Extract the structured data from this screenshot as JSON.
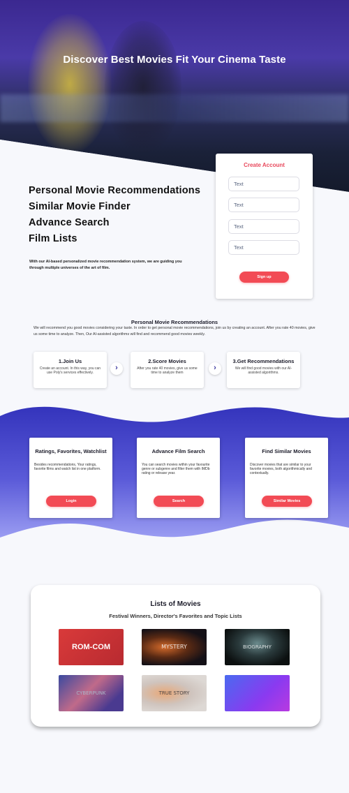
{
  "hero": {
    "title": "Discover Best Movies Fit Your Cinema Taste"
  },
  "features": [
    "Personal Movie Recommendations",
    "Similar Movie Finder",
    "Advance Search",
    "Film Lists"
  ],
  "intro": "With our AI-based personalized movie recommendation system, we are guiding you through multiple universes of the art of film.",
  "signup": {
    "title": "Create Account",
    "inputs": [
      "Text",
      "Text",
      "Text",
      "Text"
    ],
    "button": "Sign up"
  },
  "how": {
    "title": "Personal Movie Recommendations",
    "description": "We will recommend you good movies considering your taste. In order to get personal movie recommendations, join us by creating an account. After you rate 40 movies, give us some time to analyze. Then, Our AI-assisted algorithms will find and recommend good movies weekly.",
    "steps": [
      {
        "title": "1.Join Us",
        "text": "Create an account. In this way, you can use Poly's services effectively."
      },
      {
        "title": "2.Score Movies",
        "text": "After you rate 40 movies, give us some time to analyze them"
      },
      {
        "title": "3.Get Recommendations",
        "text": "We will find good movies with our AI-assisted algorithms."
      }
    ]
  },
  "feature_cards": [
    {
      "title": "Ratings, Favorites, Watchlist",
      "text": "Besides recommendations, Your ratings, favorite films and watch list in one platform.",
      "button": "Login"
    },
    {
      "title": "Advance Film Search",
      "text": "You can search movies within your favourite genre or subgenre and filter them with IMDb rating or release year.",
      "button": "Search"
    },
    {
      "title": "Find Similar Movies",
      "text": "Discover movies that are similar to your favorite movies, both algorithmically and contextually.",
      "button": "Similar Movies"
    }
  ],
  "lists": {
    "title": "Lists of Movies",
    "subtitle": "Festival Winners, Director's Favorites and Topic Lists",
    "tiles": [
      "ROM-COM",
      "MYSTERY",
      "BIOGRAPHY",
      "CYBERPUNK",
      "TRUE STORY",
      ""
    ]
  },
  "colors": {
    "accent_red": "#f24b55",
    "signup_title": "#e8485c",
    "wave_top": "#3a3ac0",
    "wave_bottom": "#8a8cf0"
  }
}
